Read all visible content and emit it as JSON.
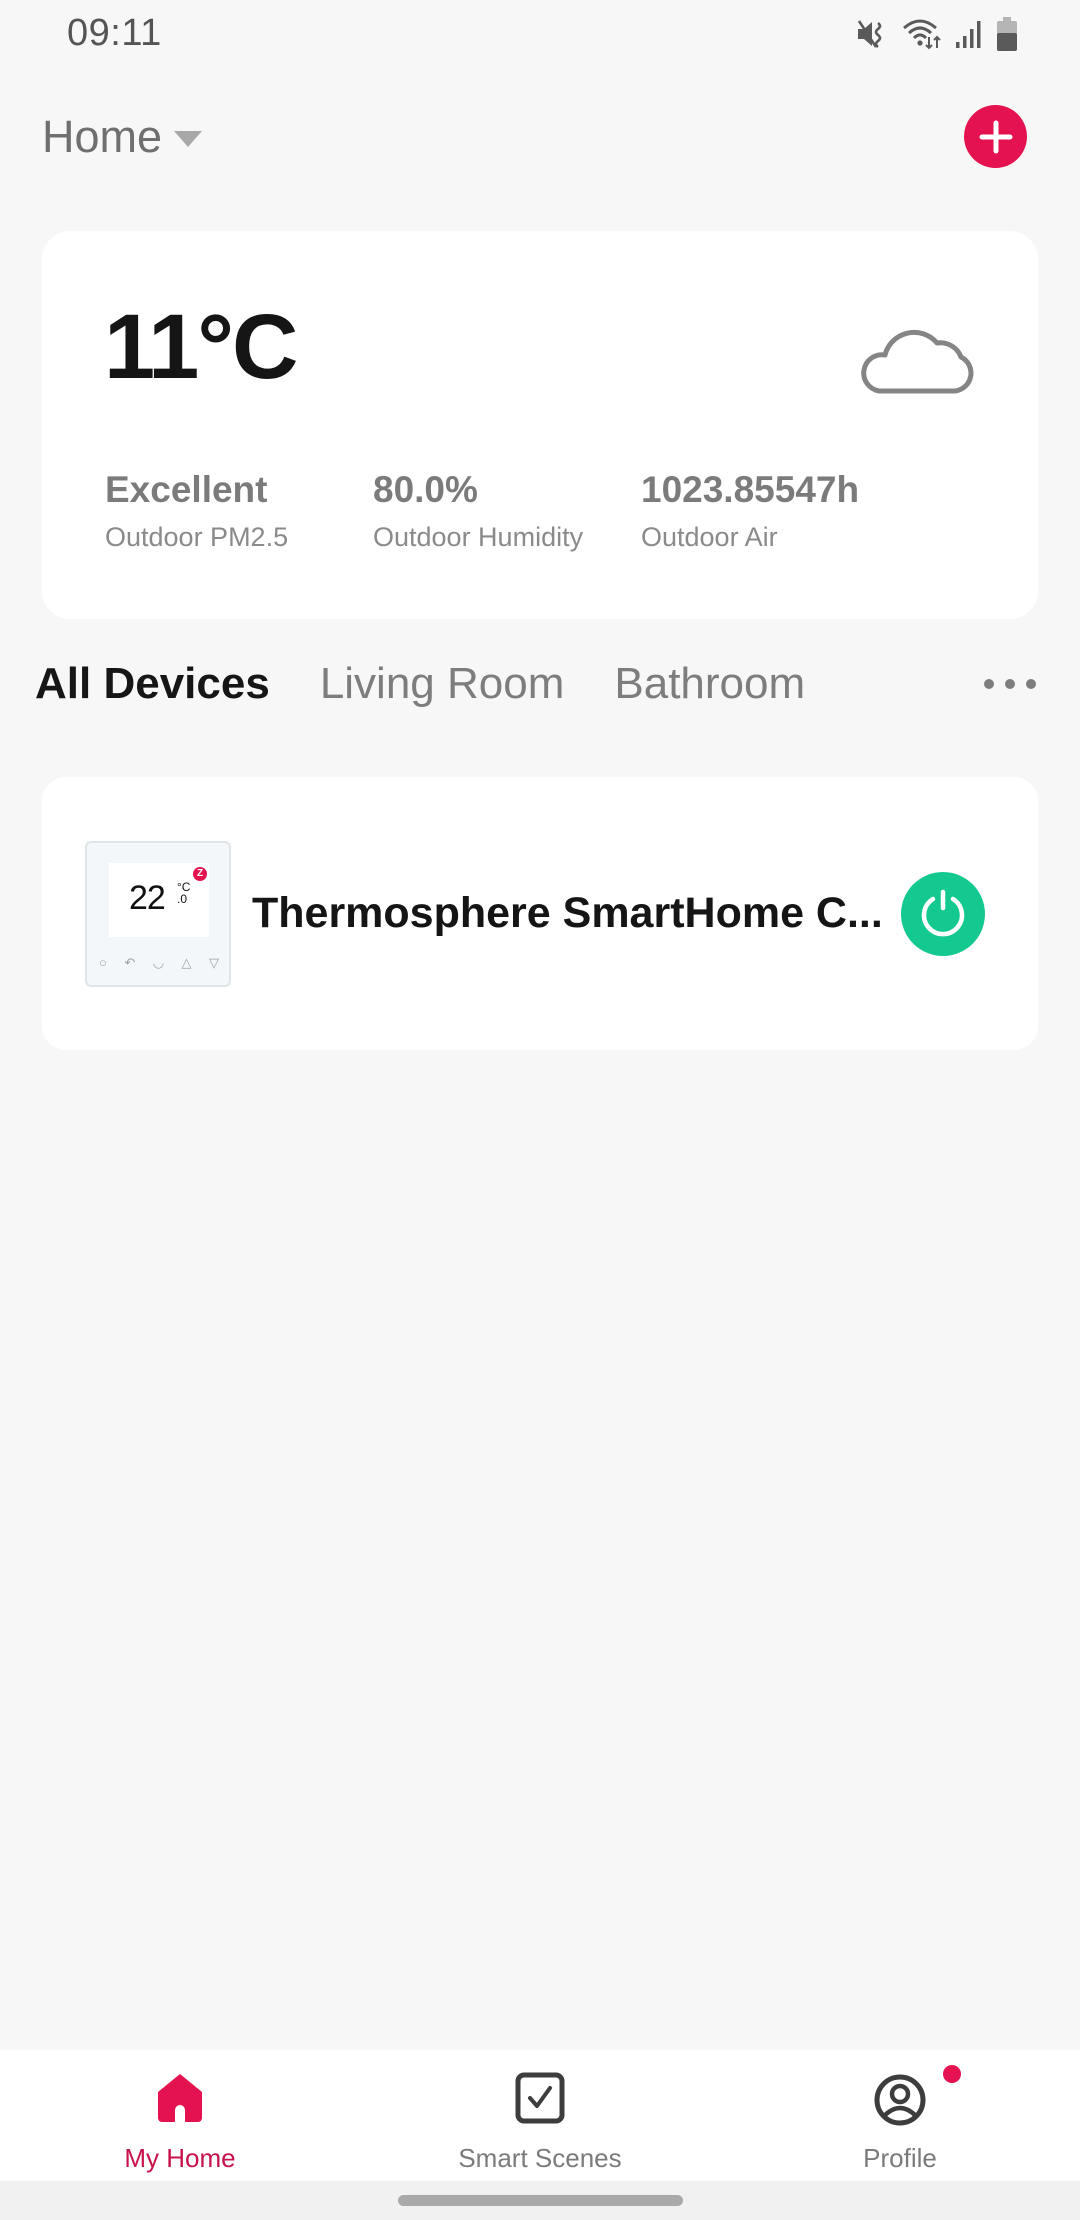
{
  "status_bar": {
    "time": "09:11",
    "icons": [
      "mute-vibrate-icon",
      "wifi-data-icon",
      "cell-signal-icon",
      "battery-icon"
    ]
  },
  "header": {
    "home_name": "Home",
    "home_dropdown_icon": "caret-down-icon",
    "add_button_icon": "plus-icon"
  },
  "weather": {
    "temperature": "11°C",
    "condition_icon": "cloud-icon",
    "stats": [
      {
        "value": "Excellent",
        "label": "Outdoor PM2.5"
      },
      {
        "value": "80.0%",
        "label": "Outdoor Humidity"
      },
      {
        "value": "1023.85547h",
        "label": "Outdoor Air"
      }
    ]
  },
  "tabs": {
    "items": [
      {
        "label": "All Devices",
        "active": true
      },
      {
        "label": "Living Room",
        "active": false
      },
      {
        "label": "Bathroom",
        "active": false
      }
    ],
    "more_icon": "more-horizontal-icon"
  },
  "devices": [
    {
      "name": "Thermosphere SmartHome C...",
      "thumbnail": {
        "display_temp": "22",
        "display_unit": "°C",
        "display_decimal": ".0",
        "badge": "Z"
      },
      "power_state": "on",
      "power_icon": "power-icon"
    }
  ],
  "bottom_nav": {
    "items": [
      {
        "label": "My Home",
        "icon": "home-icon",
        "active": true
      },
      {
        "label": "Smart Scenes",
        "icon": "checkbox-icon",
        "active": false
      },
      {
        "label": "Profile",
        "icon": "profile-icon",
        "active": false,
        "has_badge": true
      }
    ]
  },
  "colors": {
    "accent": "#e4124f",
    "nav_active_label": "#c8124a",
    "power_on": "#14c98f",
    "background": "#f7f7f7",
    "card": "#ffffff"
  }
}
